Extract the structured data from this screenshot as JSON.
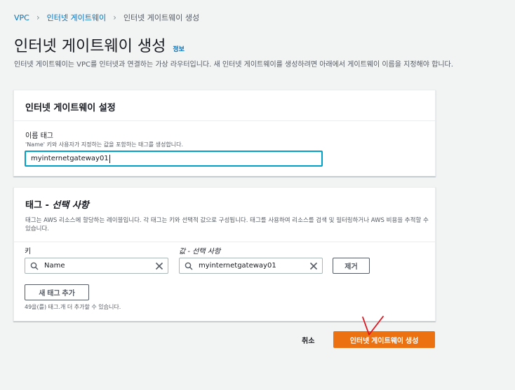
{
  "breadcrumb": {
    "items": [
      "VPC",
      "인터넷 게이트웨이",
      "인터넷 게이트웨이 생성"
    ]
  },
  "page": {
    "title": "인터넷 게이트웨이 생성",
    "info_link": "정보",
    "description": "인터넷 게이트웨이는 VPC를 인터넷과 연결하는 가상 라우터입니다. 새 인터넷 게이트웨이를 생성하려면 아래에서 게이트웨이 이름을 지정해야 합니다."
  },
  "settings_panel": {
    "header": "인터넷 게이트웨이 설정",
    "name_tag_label": "이름 태그",
    "name_tag_hint": "'Name' 키와 사용자가 지정하는 값을 포함하는 태그를 생성합니다.",
    "name_tag_value": "myinternetgateway01"
  },
  "tags_panel": {
    "header_main": "태그 - ",
    "header_optional": "선택 사항",
    "description": "태그는 AWS 리소스에 할당하는 레이블입니다. 각 태그는 키와 선택적 값으로 구성됩니다. 태그를 사용하여 리소스를 검색 및 필터링하거나 AWS 비용을 추적할 수 있습니다.",
    "key_label": "키",
    "value_label": "값 - 선택 사항",
    "rows": [
      {
        "key": "Name",
        "value": "myinternetgateway01"
      }
    ],
    "remove_button": "제거",
    "add_tag_button": "새 태그 추가",
    "remaining_text": "49을(를) 태그.개 더 추가할 수 있습니다."
  },
  "footer": {
    "cancel": "취소",
    "create": "인터넷 게이트웨이 생성"
  },
  "colors": {
    "link": "#0073bb",
    "primary": "#ec7211",
    "focus": "#00a1c9",
    "annotation": "#e0141e"
  }
}
